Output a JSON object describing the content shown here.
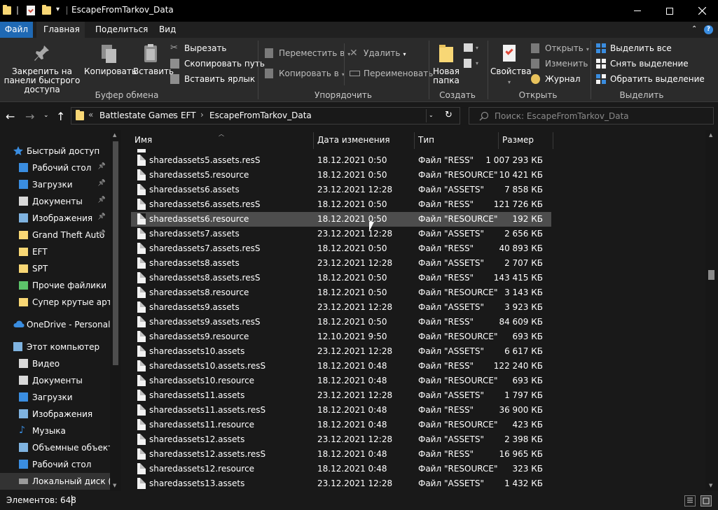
{
  "window": {
    "title": "EscapeFromTarkov_Data",
    "quick_access_caret": "▾"
  },
  "tabs": [
    {
      "label": "Файл"
    },
    {
      "label": "Главная"
    },
    {
      "label": "Поделиться"
    },
    {
      "label": "Вид"
    }
  ],
  "ribbon": {
    "clipboard": {
      "pin_label": "Закрепить на панели быстрого доступа",
      "copy_label": "Копировать",
      "paste_label": "Вставить",
      "cut_label": "Вырезать",
      "copy_path_label": "Скопировать путь",
      "paste_shortcut_label": "Вставить ярлык",
      "group_label": "Буфер обмена"
    },
    "organize": {
      "move_to_label": "Переместить в",
      "copy_to_label": "Копировать в",
      "delete_label": "Удалить",
      "rename_label": "Переименовать",
      "group_label": "Упорядочить"
    },
    "create": {
      "new_folder_label": "Новая папка",
      "group_label": "Создать"
    },
    "open": {
      "properties_label": "Свойства",
      "open_label": "Открыть",
      "edit_label": "Изменить",
      "history_label": "Журнал",
      "group_label": "Открыть"
    },
    "select": {
      "select_all_label": "Выделить все",
      "select_none_label": "Снять выделение",
      "invert_label": "Обратить выделение",
      "group_label": "Выделить"
    }
  },
  "address": {
    "overflow": "«",
    "crumbs": [
      "Battlestate Games",
      "EFT",
      "EscapeFromTarkov_Data"
    ],
    "separator": "›"
  },
  "search": {
    "placeholder": "Поиск: EscapeFromTarkov_Data"
  },
  "nav": {
    "items": [
      {
        "label": "Быстрый доступ",
        "icon": "star-icon",
        "color": "#3a8de0",
        "pinned": false,
        "level": 0
      },
      {
        "label": "Рабочий стол",
        "icon": "desktop-icon",
        "color": "#3a8de0",
        "pinned": true,
        "level": 1
      },
      {
        "label": "Загрузки",
        "icon": "download-icon",
        "color": "#3a8de0",
        "pinned": true,
        "level": 1
      },
      {
        "label": "Документы",
        "icon": "documents-icon",
        "color": "#d9d9d9",
        "pinned": true,
        "level": 1
      },
      {
        "label": "Изображения",
        "icon": "pictures-icon",
        "color": "#7fb3e0",
        "pinned": true,
        "level": 1
      },
      {
        "label": "Grand Theft Auto",
        "icon": "folder-icon",
        "color": "#f8d775",
        "pinned": true,
        "level": 1
      },
      {
        "label": "EFT",
        "icon": "folder-icon",
        "color": "#f8d775",
        "pinned": false,
        "level": 1
      },
      {
        "label": "SPT",
        "icon": "folder-icon",
        "color": "#f8d775",
        "pinned": false,
        "level": 1
      },
      {
        "label": "Прочие файлики",
        "icon": "folder-green-icon",
        "color": "#5cc46a",
        "pinned": false,
        "level": 1
      },
      {
        "label": "Супер крутые арты",
        "icon": "folder-icon",
        "color": "#f8d775",
        "pinned": false,
        "level": 1
      },
      {
        "label": "OneDrive - Personal",
        "icon": "cloud-icon",
        "color": "#3a8de0",
        "pinned": false,
        "level": 0
      },
      {
        "label": "Этот компьютер",
        "icon": "computer-icon",
        "color": "#7fb3e0",
        "pinned": false,
        "level": 0
      },
      {
        "label": "Видео",
        "icon": "video-icon",
        "color": "#d9d9d9",
        "pinned": false,
        "level": 1
      },
      {
        "label": "Документы",
        "icon": "documents-icon",
        "color": "#d9d9d9",
        "pinned": false,
        "level": 1
      },
      {
        "label": "Загрузки",
        "icon": "download-icon",
        "color": "#3a8de0",
        "pinned": false,
        "level": 1
      },
      {
        "label": "Изображения",
        "icon": "pictures-icon",
        "color": "#7fb3e0",
        "pinned": false,
        "level": 1
      },
      {
        "label": "Музыка",
        "icon": "music-icon",
        "color": "#3a8de0",
        "pinned": false,
        "level": 1
      },
      {
        "label": "Объемные объекты",
        "icon": "3d-objects-icon",
        "color": "#7fb3e0",
        "pinned": false,
        "level": 1
      },
      {
        "label": "Рабочий стол",
        "icon": "desktop-icon",
        "color": "#3a8de0",
        "pinned": false,
        "level": 1
      },
      {
        "label": "Локальный диск (C:)",
        "icon": "drive-icon",
        "color": "#9a9a9a",
        "pinned": false,
        "level": 1,
        "selected": true
      }
    ]
  },
  "columns": {
    "name": "Имя",
    "date": "Дата изменения",
    "type": "Тип",
    "size": "Размер"
  },
  "files": [
    {
      "name": "sharedassets5.assets.resS",
      "date": "18.12.2021 0:50",
      "type": "Файл \"RESS\"",
      "size": "1 007 293 КБ"
    },
    {
      "name": "sharedassets5.resource",
      "date": "18.12.2021 0:50",
      "type": "Файл \"RESOURCE\"",
      "size": "10 421 КБ"
    },
    {
      "name": "sharedassets6.assets",
      "date": "23.12.2021 12:28",
      "type": "Файл \"ASSETS\"",
      "size": "7 858 КБ"
    },
    {
      "name": "sharedassets6.assets.resS",
      "date": "18.12.2021 0:50",
      "type": "Файл \"RESS\"",
      "size": "121 726 КБ"
    },
    {
      "name": "sharedassets6.resource",
      "date": "18.12.2021 0:50",
      "type": "Файл \"RESOURCE\"",
      "size": "192 КБ",
      "hover": true
    },
    {
      "name": "sharedassets7.assets",
      "date": "23.12.2021 12:28",
      "type": "Файл \"ASSETS\"",
      "size": "2 656 КБ"
    },
    {
      "name": "sharedassets7.assets.resS",
      "date": "18.12.2021 0:50",
      "type": "Файл \"RESS\"",
      "size": "40 893 КБ"
    },
    {
      "name": "sharedassets8.assets",
      "date": "23.12.2021 12:28",
      "type": "Файл \"ASSETS\"",
      "size": "2 707 КБ"
    },
    {
      "name": "sharedassets8.assets.resS",
      "date": "18.12.2021 0:50",
      "type": "Файл \"RESS\"",
      "size": "143 415 КБ"
    },
    {
      "name": "sharedassets8.resource",
      "date": "18.12.2021 0:50",
      "type": "Файл \"RESOURCE\"",
      "size": "3 143 КБ"
    },
    {
      "name": "sharedassets9.assets",
      "date": "23.12.2021 12:28",
      "type": "Файл \"ASSETS\"",
      "size": "3 923 КБ"
    },
    {
      "name": "sharedassets9.assets.resS",
      "date": "18.12.2021 0:50",
      "type": "Файл \"RESS\"",
      "size": "84 609 КБ"
    },
    {
      "name": "sharedassets9.resource",
      "date": "12.10.2021 9:50",
      "type": "Файл \"RESOURCE\"",
      "size": "693 КБ"
    },
    {
      "name": "sharedassets10.assets",
      "date": "23.12.2021 12:28",
      "type": "Файл \"ASSETS\"",
      "size": "6 617 КБ"
    },
    {
      "name": "sharedassets10.assets.resS",
      "date": "18.12.2021 0:48",
      "type": "Файл \"RESS\"",
      "size": "122 240 КБ"
    },
    {
      "name": "sharedassets10.resource",
      "date": "18.12.2021 0:48",
      "type": "Файл \"RESOURCE\"",
      "size": "693 КБ"
    },
    {
      "name": "sharedassets11.assets",
      "date": "23.12.2021 12:28",
      "type": "Файл \"ASSETS\"",
      "size": "1 797 КБ"
    },
    {
      "name": "sharedassets11.assets.resS",
      "date": "18.12.2021 0:48",
      "type": "Файл \"RESS\"",
      "size": "36 900 КБ"
    },
    {
      "name": "sharedassets11.resource",
      "date": "18.12.2021 0:48",
      "type": "Файл \"RESOURCE\"",
      "size": "423 КБ"
    },
    {
      "name": "sharedassets12.assets",
      "date": "23.12.2021 12:28",
      "type": "Файл \"ASSETS\"",
      "size": "2 398 КБ"
    },
    {
      "name": "sharedassets12.assets.resS",
      "date": "18.12.2021 0:48",
      "type": "Файл \"RESS\"",
      "size": "16 965 КБ"
    },
    {
      "name": "sharedassets12.resource",
      "date": "18.12.2021 0:48",
      "type": "Файл \"RESOURCE\"",
      "size": "323 КБ"
    },
    {
      "name": "sharedassets13.assets",
      "date": "23.12.2021 12:28",
      "type": "Файл \"ASSETS\"",
      "size": "1 432 КБ"
    }
  ],
  "status": {
    "items_count": "Элементов: 648"
  },
  "colors": {
    "accent": "#1f69b4",
    "folder": "#f8d775",
    "hover_row": "#4d4d4d"
  }
}
